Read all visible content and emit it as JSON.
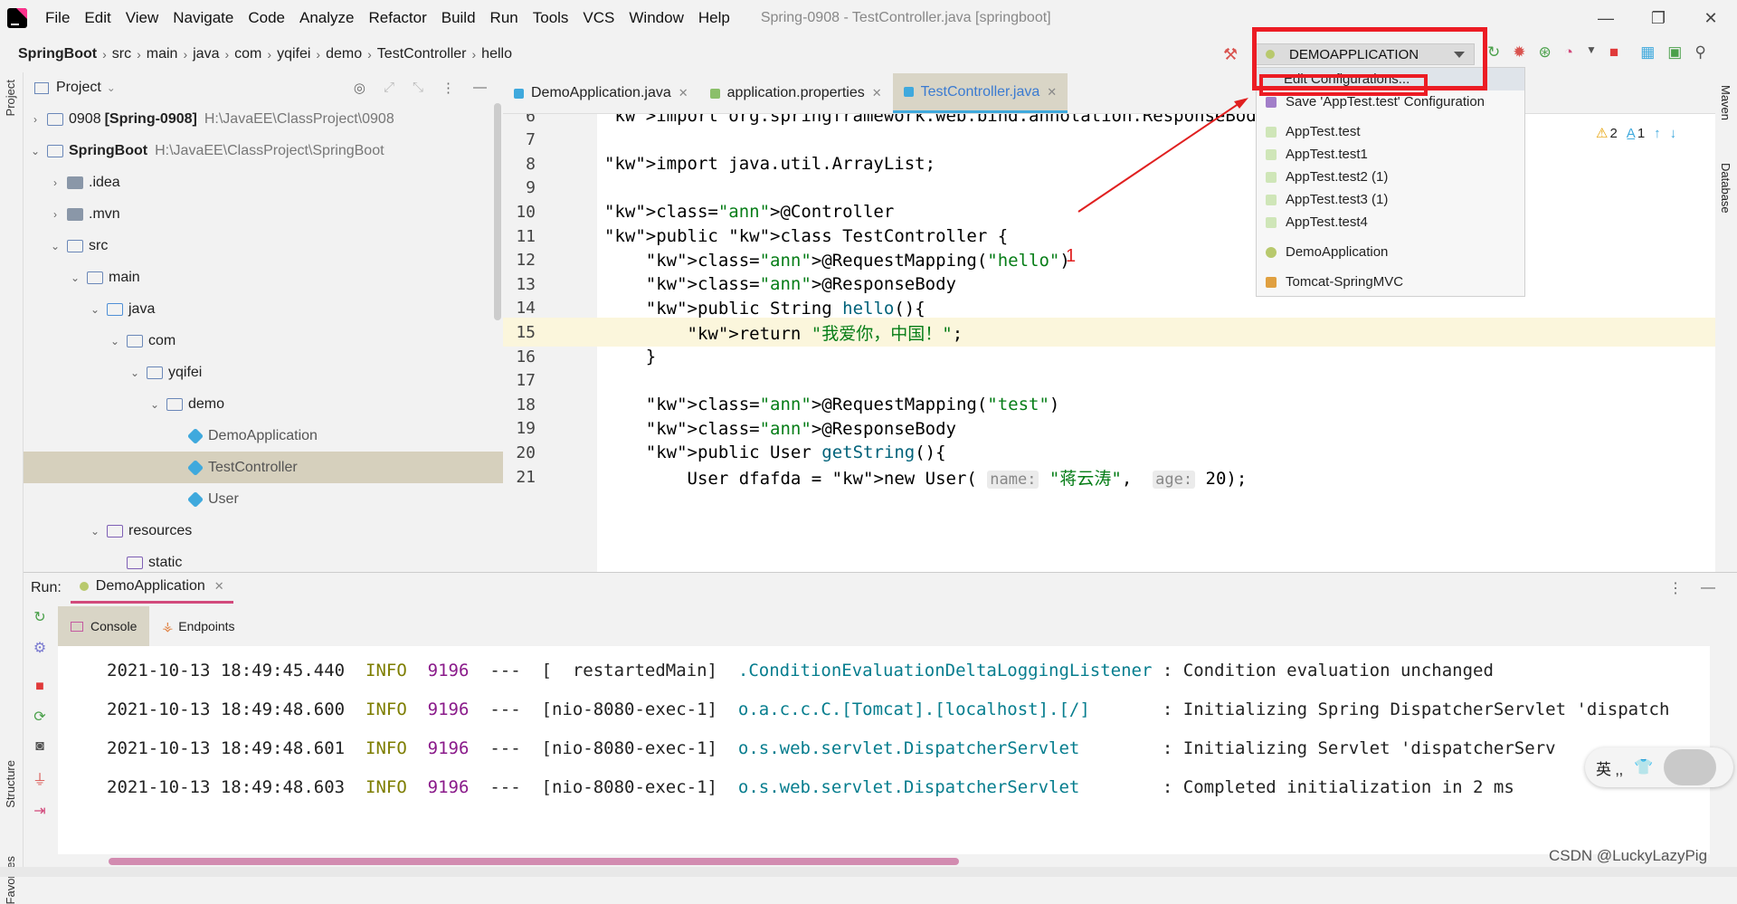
{
  "window": {
    "title": "Spring-0908 - TestController.java [springboot]",
    "menu": [
      "File",
      "Edit",
      "View",
      "Navigate",
      "Code",
      "Analyze",
      "Refactor",
      "Build",
      "Run",
      "Tools",
      "VCS",
      "Window",
      "Help"
    ]
  },
  "breadcrumb": [
    "SpringBoot",
    "src",
    "main",
    "java",
    "com",
    "yqifei",
    "demo",
    "TestController",
    "hello"
  ],
  "run_config": {
    "selected": "DEMOAPPLICATION",
    "menu": {
      "edit": "Edit Configurations...",
      "save": "Save 'AppTest.test' Configuration",
      "configs": [
        "AppTest.test",
        "AppTest.test1",
        "AppTest.test2 (1)",
        "AppTest.test3 (1)",
        "AppTest.test4",
        "DemoApplication",
        "Tomcat-SpringMVC"
      ]
    }
  },
  "project_panel": {
    "title": "Project",
    "tree": [
      {
        "name": "0908",
        "bold": "[Spring-0908]",
        "path": "H:\\JavaEE\\ClassProject\\0908",
        "depth": 0,
        "open": false
      },
      {
        "name": "SpringBoot",
        "path": "H:\\JavaEE\\ClassProject\\SpringBoot",
        "depth": 0,
        "open": true
      },
      {
        "name": ".idea",
        "depth": 1,
        "open": false
      },
      {
        "name": ".mvn",
        "depth": 1,
        "open": false
      },
      {
        "name": "src",
        "depth": 1,
        "open": true
      },
      {
        "name": "main",
        "depth": 2,
        "open": true
      },
      {
        "name": "java",
        "depth": 3,
        "open": true
      },
      {
        "name": "com",
        "depth": 4,
        "open": true
      },
      {
        "name": "yqifei",
        "depth": 5,
        "open": true
      },
      {
        "name": "demo",
        "depth": 6,
        "open": true
      },
      {
        "name": "DemoApplication",
        "depth": 7
      },
      {
        "name": "TestController",
        "depth": 7
      },
      {
        "name": "User",
        "depth": 7
      },
      {
        "name": "resources",
        "depth": 3,
        "open": true
      },
      {
        "name": "static",
        "depth": 4
      }
    ]
  },
  "editor": {
    "tabs": [
      "DemoApplication.java",
      "application.properties",
      "TestController.java"
    ],
    "active_tab": "TestController.java",
    "inspections": {
      "warnings": "2",
      "typos": "1"
    },
    "lines": [
      {
        "n": "6",
        "text": "import org.springframework.web.bind.annotation.ResponseBody;"
      },
      {
        "n": "7",
        "text": ""
      },
      {
        "n": "8",
        "text": "import java.util.ArrayList;"
      },
      {
        "n": "9",
        "text": ""
      },
      {
        "n": "10",
        "text": "@Controller"
      },
      {
        "n": "11",
        "text": "public class TestController {"
      },
      {
        "n": "12",
        "text": "    @RequestMapping(\"hello\")"
      },
      {
        "n": "13",
        "text": "    @ResponseBody"
      },
      {
        "n": "14",
        "text": "    public String hello(){"
      },
      {
        "n": "15",
        "text": "        return \"我爱你，中国！\";"
      },
      {
        "n": "16",
        "text": "    }"
      },
      {
        "n": "17",
        "text": ""
      },
      {
        "n": "18",
        "text": "    @RequestMapping(\"test\")"
      },
      {
        "n": "19",
        "text": "    @ResponseBody"
      },
      {
        "n": "20",
        "text": "    public User getString(){"
      },
      {
        "n": "21",
        "text": "        User dfafda = new User( name: \"蒋云涛\",  age: 20);"
      }
    ],
    "annotation_label": "1"
  },
  "run_panel": {
    "label": "Run:",
    "tab": "DemoApplication",
    "subtabs": [
      "Console",
      "Endpoints"
    ],
    "log": [
      {
        "ts": "2021-10-13 18:49:45.440",
        "level": "INFO",
        "pid": "9196",
        "thread": "---  [  restartedMain]",
        "logger": ".ConditionEvaluationDeltaLoggingListener",
        "msg": " : Condition evaluation unchanged"
      },
      {
        "ts": "2021-10-13 18:49:48.600",
        "level": "INFO",
        "pid": "9196",
        "thread": "---  [nio-8080-exec-1]",
        "logger": "o.a.c.c.C.[Tomcat].[localhost].[/]",
        "msg": "       : Initializing Spring DispatcherServlet 'dispatch"
      },
      {
        "ts": "2021-10-13 18:49:48.601",
        "level": "INFO",
        "pid": "9196",
        "thread": "---  [nio-8080-exec-1]",
        "logger": "o.s.web.servlet.DispatcherServlet",
        "msg": "        : Initializing Servlet 'dispatcherServ"
      },
      {
        "ts": "2021-10-13 18:49:48.603",
        "level": "INFO",
        "pid": "9196",
        "thread": "---  [nio-8080-exec-1]",
        "logger": "o.s.web.servlet.DispatcherServlet",
        "msg": "        : Completed initialization in 2 ms"
      }
    ]
  },
  "side_tools": {
    "left": [
      "Project",
      "Structure",
      "Favorites"
    ],
    "right": [
      "Maven",
      "Database"
    ]
  },
  "ime": {
    "text": "英 ‚,"
  },
  "watermark": "CSDN @LuckyLazyPig",
  "colors": {
    "highlight_red": "#ec1c24",
    "accent_blue": "#3fa9dd",
    "run_tab_pink": "#d24a7c"
  }
}
